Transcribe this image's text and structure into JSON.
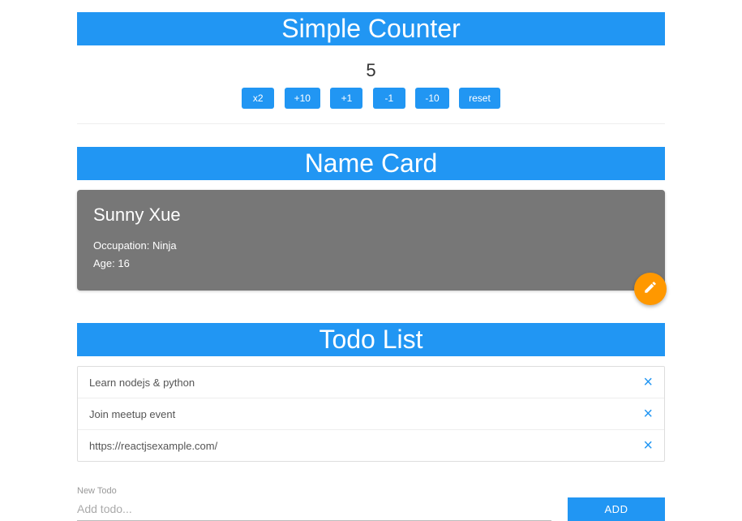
{
  "counter": {
    "title": "Simple Counter",
    "value": "5",
    "buttons": [
      "x2",
      "+10",
      "+1",
      "-1",
      "-10",
      "reset"
    ]
  },
  "namecard": {
    "title": "Name Card",
    "name": "Sunny Xue",
    "occupation_label": "Occupation:",
    "occupation_value": "Ninja",
    "age_label": "Age:",
    "age_value": "16"
  },
  "todo": {
    "title": "Todo List",
    "items": [
      "Learn nodejs & python",
      "Join meetup event",
      "https://reactjsexample.com/"
    ],
    "input_label": "New Todo",
    "input_placeholder": "Add todo...",
    "add_label": "ADD"
  }
}
